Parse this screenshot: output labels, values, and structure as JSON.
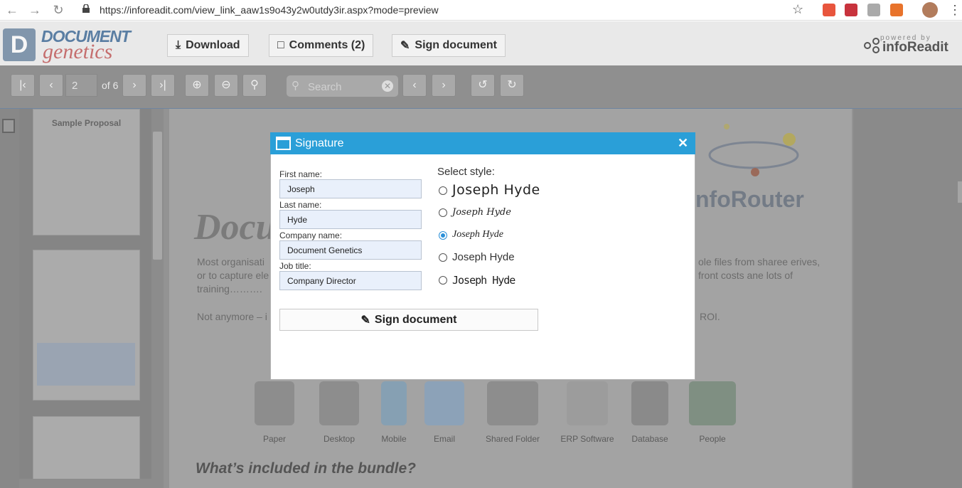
{
  "browser": {
    "url": "https://inforeadit.com/view_link_aaw1s9o43y2w0utdy3ir.aspx?mode=preview",
    "back_icon": "arrow-left-icon",
    "forward_icon": "arrow-right-icon",
    "reload_icon": "reload-icon"
  },
  "header": {
    "logo_top": "DOCUMENT",
    "logo_bottom": "genetics",
    "download_label": "Download",
    "comments_label": "Comments (2)",
    "sign_label": "Sign document",
    "powered_small": "powered by",
    "powered_big": "infoReadit"
  },
  "toolbar": {
    "page_value": "2",
    "page_total": "of 6",
    "search_placeholder": "Search"
  },
  "thumbnails": {
    "first_title": "Sample Proposal"
  },
  "document": {
    "heading": "Docu",
    "para1_left": "Most organisati",
    "para1_left2": "or to capture ele",
    "para1_left3": "training……….",
    "para1_right": "ole files from sharee erives,",
    "para1_right2": "front costs ane lots of",
    "para2_left": "Not anymore – i",
    "para2_right": "ROI.",
    "brand_text": "nfoRouter",
    "categories": [
      "Paper",
      "Desktop",
      "Mobile",
      "Email",
      "Shared Folder",
      "ERP Software",
      "Database",
      "People"
    ],
    "section_heading": "What’s included in the bundle?"
  },
  "dialog": {
    "title": "Signature",
    "first_name_label": "First name:",
    "first_name_value": "Joseph",
    "last_name_label": "Last name:",
    "last_name_value": "Hyde",
    "company_label": "Company name:",
    "company_value": "Document Genetics",
    "job_label": "Job title:",
    "job_value": "Company Director",
    "select_style_label": "Select style:",
    "styles": [
      "Joseph Hyde",
      "Joseph Hyde",
      "Joseph Hyde",
      "Joseph Hyde",
      "Joseph Hyde"
    ],
    "selected_style_index": 2,
    "sign_button_label": "Sign document"
  }
}
